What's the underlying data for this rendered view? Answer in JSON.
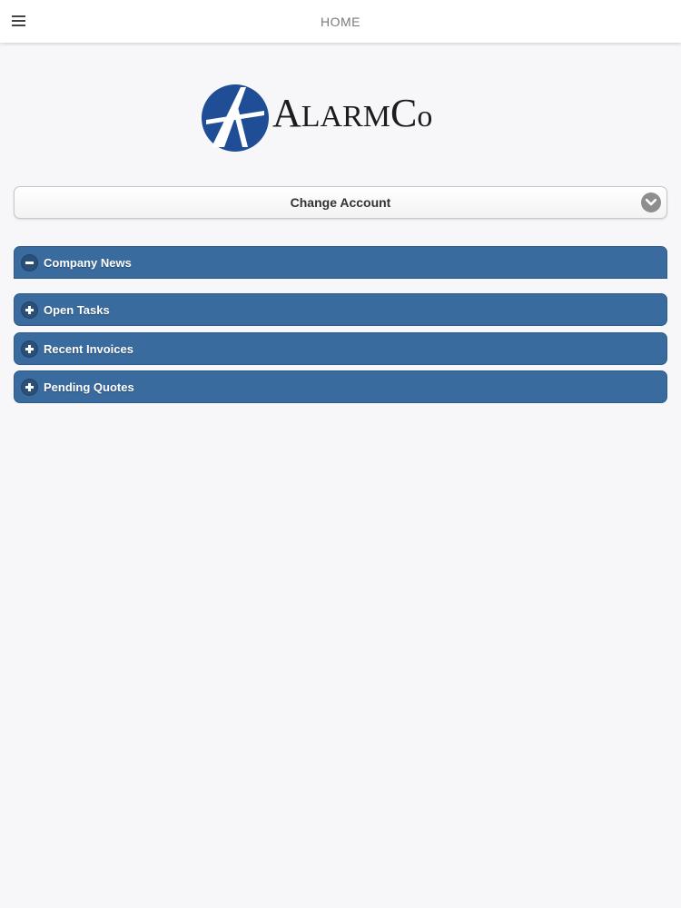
{
  "header": {
    "title": "HOME",
    "menu_icon": "hamburger-menu-icon"
  },
  "logo": {
    "brand": "AlarmCo",
    "color": "#1f4e96"
  },
  "account_select": {
    "label": "Change Account",
    "icon": "chevron-down-icon"
  },
  "panels": [
    {
      "label": "Company News",
      "state": "expanded",
      "icon": "minus-icon"
    },
    {
      "label": "Open Tasks",
      "state": "collapsed",
      "icon": "plus-icon"
    },
    {
      "label": "Recent Invoices",
      "state": "collapsed",
      "icon": "plus-icon"
    },
    {
      "label": "Pending Quotes",
      "state": "collapsed",
      "icon": "plus-icon"
    }
  ],
  "colors": {
    "panel_bg": "#3a6b9f",
    "page_bg": "#f7f7f9"
  }
}
